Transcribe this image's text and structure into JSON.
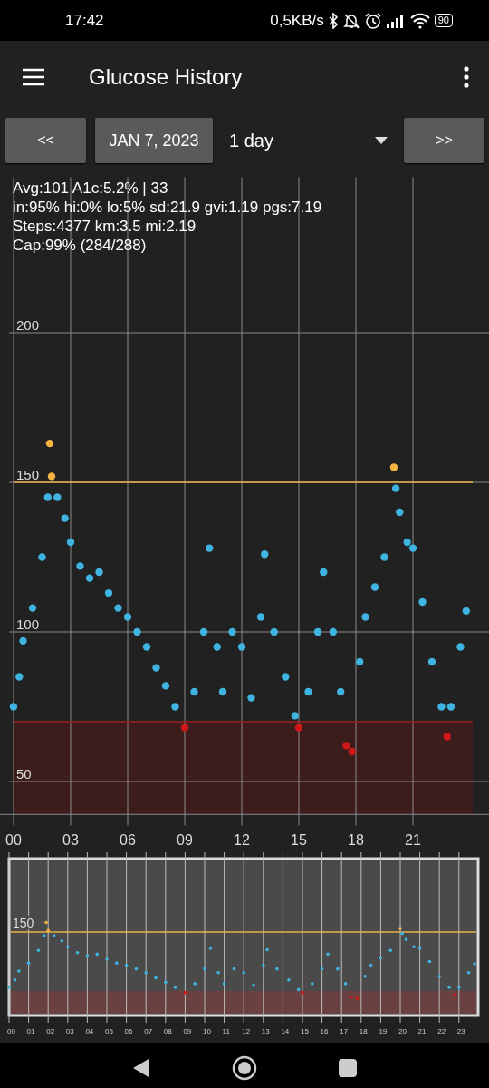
{
  "status_bar": {
    "time": "17:42",
    "net_speed": "0,5KB/s",
    "battery": "90"
  },
  "app_bar": {
    "title": "Glucose History"
  },
  "controls": {
    "prev": "<<",
    "date": "JAN 7, 2023",
    "range": "1 day",
    "next": ">>"
  },
  "stats": [
    "Avg:101 A1c:5.2% | 33",
    "in:95% hi:0% lo:5% sd:21.9 gvi:1.19 pgs:7.19",
    "Steps:4377 km:3.5 mi:2.19",
    "Cap:99% (284/288)"
  ],
  "chart_data": {
    "type": "scatter",
    "xlim": [
      0,
      24
    ],
    "ylim": [
      39,
      252
    ],
    "grid": true,
    "xticks": [
      {
        "value": 0,
        "label": "00"
      },
      {
        "value": 3,
        "label": "03"
      },
      {
        "value": 6,
        "label": "06"
      },
      {
        "value": 9,
        "label": "09"
      },
      {
        "value": 12,
        "label": "12"
      },
      {
        "value": 15,
        "label": "15"
      },
      {
        "value": 18,
        "label": "18"
      },
      {
        "value": 21,
        "label": "21"
      }
    ],
    "yticks": [
      50,
      100,
      150,
      200
    ],
    "x": [
      0,
      0.3,
      0.5,
      1,
      1.5,
      1.8,
      1.9,
      2,
      2.3,
      2.7,
      3,
      3.5,
      4,
      4.5,
      5,
      5.5,
      6,
      6.5,
      7,
      7.5,
      8,
      8.5,
      9,
      9.5,
      10,
      10.3,
      10.7,
      11,
      11.5,
      12,
      12.5,
      13,
      13.2,
      13.7,
      14.3,
      14.8,
      15,
      15.5,
      16,
      16.3,
      16.8,
      17.2,
      17.5,
      17.8,
      18.2,
      18.5,
      19,
      19.5,
      20,
      20.1,
      20.3,
      20.7,
      21,
      21.5,
      22,
      22.5,
      22.8,
      23,
      23.5,
      23.8
    ],
    "series": [
      {
        "color": "#3fb4e0",
        "values": [
          75,
          85,
          97,
          108,
          125,
          145,
          null,
          null,
          145,
          138,
          130,
          122,
          118,
          120,
          113,
          108,
          105,
          100,
          95,
          88,
          82,
          75,
          null,
          80,
          100,
          128,
          95,
          80,
          100,
          95,
          78,
          105,
          126,
          100,
          85,
          72,
          null,
          80,
          100,
          120,
          100,
          80,
          null,
          null,
          90,
          105,
          115,
          125,
          null,
          148,
          140,
          130,
          128,
          110,
          90,
          75,
          null,
          75,
          95,
          107
        ]
      },
      {
        "color": "#f5b342",
        "values": [
          null,
          null,
          null,
          null,
          null,
          null,
          163,
          152,
          null,
          null,
          null,
          null,
          null,
          null,
          null,
          null,
          null,
          null,
          null,
          null,
          null,
          null,
          null,
          null,
          null,
          null,
          null,
          null,
          null,
          null,
          null,
          null,
          null,
          null,
          null,
          null,
          null,
          null,
          null,
          null,
          null,
          null,
          null,
          null,
          null,
          null,
          null,
          null,
          155,
          null,
          null,
          null,
          null,
          null,
          null,
          null,
          null,
          null,
          null,
          null
        ]
      },
      {
        "color": "#d01818",
        "values": [
          null,
          null,
          null,
          null,
          null,
          null,
          null,
          null,
          null,
          null,
          null,
          null,
          null,
          null,
          null,
          null,
          null,
          null,
          null,
          null,
          null,
          null,
          68,
          null,
          null,
          null,
          null,
          null,
          null,
          null,
          null,
          null,
          null,
          null,
          null,
          null,
          68,
          null,
          null,
          null,
          null,
          null,
          62,
          60,
          null,
          null,
          null,
          null,
          null,
          null,
          null,
          null,
          null,
          null,
          null,
          null,
          65,
          null,
          null,
          null
        ]
      }
    ],
    "ref_lines": [
      {
        "axis": "y",
        "value": 150,
        "color": "#e8b04a"
      },
      {
        "axis": "y",
        "value": 70,
        "color": "#a01c1c"
      }
    ],
    "bands": [
      {
        "axis": "y",
        "from": 39,
        "to": 70,
        "color": "#3d1c1c"
      }
    ]
  },
  "overview": {
    "level_label": "150",
    "hour_labels": [
      "00",
      "01",
      "02",
      "03",
      "04",
      "05",
      "06",
      "07",
      "08",
      "09",
      "10",
      "11",
      "12",
      "13",
      "14",
      "15",
      "16",
      "17",
      "18",
      "19",
      "20",
      "21",
      "22",
      "23"
    ]
  }
}
